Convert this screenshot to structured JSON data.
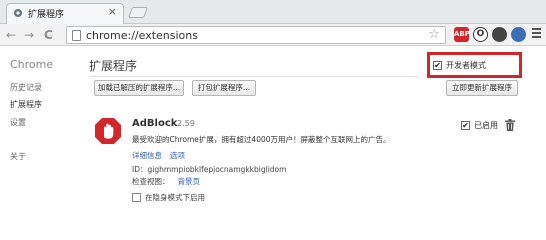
{
  "tab": {
    "title": "扩展程序",
    "close": "×"
  },
  "nav": {
    "back": "←",
    "forward": "→",
    "reload": "C"
  },
  "address": {
    "url": "chrome://extensions",
    "star": "☆"
  },
  "toolbar_icons": [
    {
      "name": "adblock-icon",
      "text": "ABP",
      "color": "#d3262a"
    },
    {
      "name": "opera-icon",
      "text": "O",
      "color": "#333333"
    },
    {
      "name": "tamper-icon",
      "text": "",
      "color": "#444444"
    },
    {
      "name": "lastpass-icon",
      "text": "",
      "color": "#3b6fb6"
    }
  ],
  "sidebar": {
    "brand": "Chrome",
    "items": [
      {
        "label": "历史记录"
      },
      {
        "label": "扩展程序"
      },
      {
        "label": "设置"
      },
      {
        "label": "关于"
      }
    ]
  },
  "page": {
    "title": "扩展程序",
    "developer_mode_label": "开发者模式",
    "developer_mode_checked": "✔",
    "buttons": {
      "load_unpacked": "加载已解压的扩展程序...",
      "pack": "打包扩展程序...",
      "update_now": "立即更新扩展程序"
    }
  },
  "extension": {
    "name": "AdBlock",
    "version": "2.59",
    "description": "最受欢迎的Chrome扩展，拥有超过4000万用户！屏蔽整个互联网上的广告。",
    "details_link": "详细信息",
    "options_link": "选项",
    "id_label": "ID：",
    "id_value": "gighmmpiobklfepjocnamgkkbiglidom",
    "inspect_label": "检查视图：",
    "background_page_link": "背景页",
    "incognito_label": "在隐身模式下启用",
    "enabled_label": "已启用",
    "enabled_checked": "✔"
  },
  "colors": {
    "highlight_border": "#d3262a",
    "link": "#2a5db0",
    "adblock_red": "#d3262a"
  }
}
